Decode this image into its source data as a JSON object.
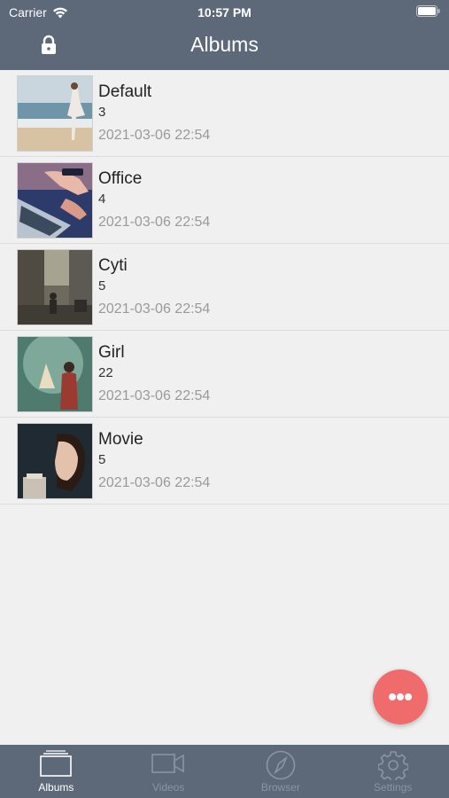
{
  "status_bar": {
    "carrier": "Carrier",
    "time": "10:57 PM"
  },
  "header": {
    "title": "Albums",
    "left_icon": "lock-icon"
  },
  "albums": [
    {
      "name": "Default",
      "count": "3",
      "date": "2021-03-06 22:54"
    },
    {
      "name": "Office",
      "count": "4",
      "date": "2021-03-06 22:54"
    },
    {
      "name": "Cyti",
      "count": "5",
      "date": "2021-03-06 22:54"
    },
    {
      "name": "Girl",
      "count": "22",
      "date": "2021-03-06 22:54"
    },
    {
      "name": "Movie",
      "count": "5",
      "date": "2021-03-06 22:54"
    }
  ],
  "fab": {
    "icon": "more-icon",
    "color": "#f06b6b"
  },
  "tabbar": {
    "tabs": [
      {
        "label": "Albums",
        "icon": "albums-icon",
        "active": true
      },
      {
        "label": "Videos",
        "icon": "video-camera-icon",
        "active": false
      },
      {
        "label": "Browser",
        "icon": "compass-icon",
        "active": false
      },
      {
        "label": "Settings",
        "icon": "gear-icon",
        "active": false
      }
    ]
  },
  "colors": {
    "bar": "#5d6879",
    "background": "#f0f0f0",
    "accent": "#f06b6b"
  }
}
